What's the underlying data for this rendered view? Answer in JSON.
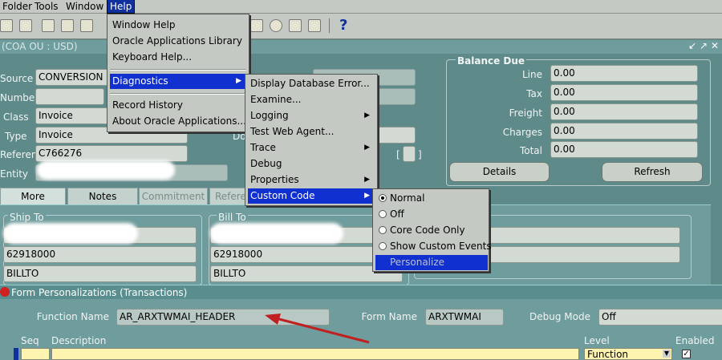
{
  "menubar": {
    "items": [
      "Folder",
      "Tools",
      "Window",
      "Help"
    ]
  },
  "window": {
    "title": "(COA OU : USD)"
  },
  "header": {
    "source_label": "Source",
    "source_value": "CONVERSION",
    "number_label": "Number",
    "class_label": "Class",
    "class_value": "Invoice",
    "type_label": "Type",
    "type_value": "Invoice",
    "reference_label": "Reference",
    "reference_value": "C766276",
    "entity_label": "Entity",
    "do_label": "Do"
  },
  "balance_due": {
    "title": "Balance Due",
    "rows": [
      {
        "label": "Line",
        "value": "0.00"
      },
      {
        "label": "Tax",
        "value": "0.00"
      },
      {
        "label": "Freight",
        "value": "0.00"
      },
      {
        "label": "Charges",
        "value": "0.00"
      },
      {
        "label": "Total",
        "value": "0.00"
      }
    ],
    "details_button": "Details",
    "refresh_button": "Refresh"
  },
  "tabs": [
    "More",
    "Notes",
    "Commitment",
    "Refere"
  ],
  "ship_to": {
    "title": "Ship To",
    "number": "62918000",
    "site": "BILLTO"
  },
  "bill_to": {
    "title": "Bill To",
    "number": "62918000",
    "site": "BILLTO"
  },
  "help_menu": {
    "items": [
      "Window Help",
      "Oracle Applications Library",
      "Keyboard Help...",
      "Diagnostics",
      "Record History",
      "About Oracle Applications..."
    ]
  },
  "diagnostics_menu": {
    "items": [
      "Display Database Error...",
      "Examine...",
      "Logging",
      "Test Web Agent...",
      "Trace",
      "Debug",
      "Properties",
      "Custom Code"
    ]
  },
  "custom_code_menu": {
    "items": [
      "Normal",
      "Off",
      "Core Code Only",
      "Show Custom Events",
      "Personalize"
    ],
    "selected": "Normal"
  },
  "form_personalizations": {
    "title": "Form Personalizations (Transactions)",
    "function_name_label": "Function Name",
    "function_name_value": "AR_ARXTWMAI_HEADER",
    "form_name_label": "Form Name",
    "form_name_value": "ARXTWMAI",
    "debug_mode_label": "Debug Mode",
    "debug_mode_value": "Off",
    "columns": {
      "seq": "Seq",
      "description": "Description",
      "level": "Level",
      "enabled": "Enabled"
    },
    "level_value": "Function"
  },
  "colors": {
    "menu_highlight": "#1030d0",
    "arrow": "#c02020",
    "row_yellow": "#fff3b0"
  }
}
